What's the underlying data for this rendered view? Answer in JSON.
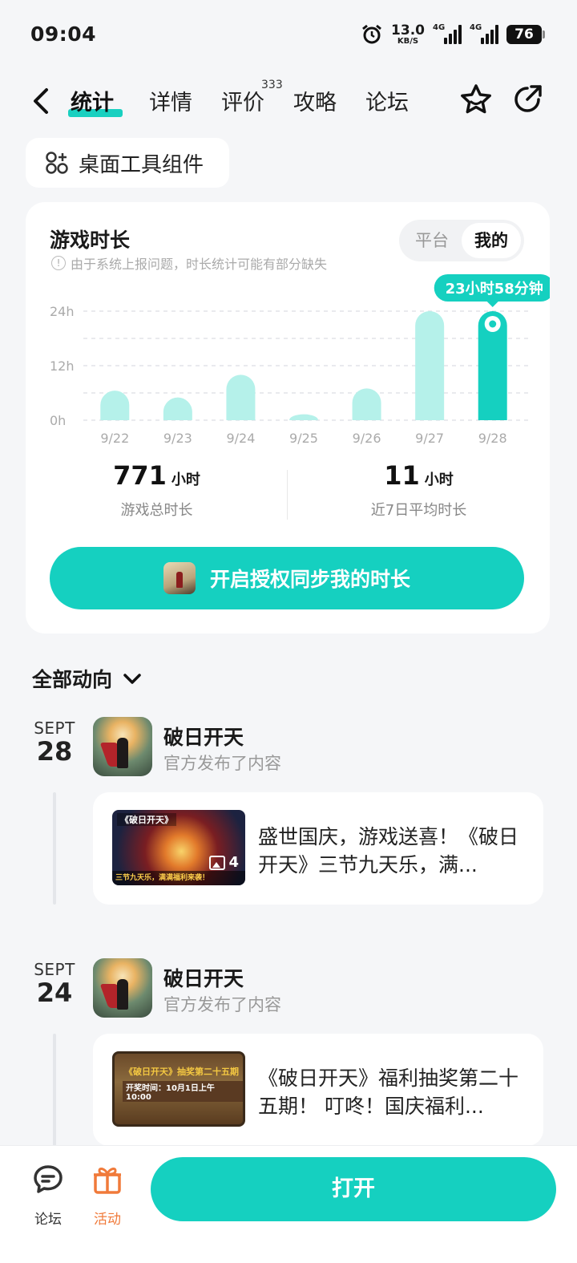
{
  "status_bar": {
    "time": "09:04",
    "speed_value": "13.0",
    "speed_unit": "KB/S",
    "signal1": "4G",
    "signal2": "4G",
    "battery": "76"
  },
  "header": {
    "tabs": [
      {
        "label": "统计"
      },
      {
        "label": "详情"
      },
      {
        "label": "评价"
      },
      {
        "label": "攻略"
      },
      {
        "label": "论坛"
      }
    ],
    "review_count": "333"
  },
  "widget_chip": {
    "label": "桌面工具组件"
  },
  "stats_card": {
    "title": "游戏时长",
    "note": "由于系统上报问题，时长统计可能有部分缺失",
    "toggle": [
      "平台",
      "我的"
    ],
    "tooltip": "23小时58分钟",
    "total_hours": "771",
    "total_unit": "小时",
    "total_label": "游戏总时长",
    "avg_hours": "11",
    "avg_unit": "小时",
    "avg_label": "近7日平均时长",
    "sync_button": "开启授权同步我的时长"
  },
  "chart_data": {
    "type": "bar",
    "categories": [
      "9/22",
      "9/23",
      "9/24",
      "9/25",
      "9/26",
      "9/27",
      "9/28"
    ],
    "values": [
      6.5,
      5,
      10,
      1.3,
      7,
      24,
      24
    ],
    "highlight_index": 6,
    "ylim": [
      0,
      24
    ],
    "yticks": [
      "0h",
      "12h",
      "24h"
    ],
    "colors": {
      "normal": "#b5f1ea",
      "highlight": "#15d0c0"
    }
  },
  "feed": {
    "title": "全部动向",
    "items": [
      {
        "month": "SEPT",
        "day": "28",
        "author": "破日开天",
        "sub": "官方发布了内容",
        "thumb_title": "《破日开天》",
        "thumb_caption": "三节九天乐，满满福利来袭！",
        "image_count": "4",
        "text": "盛世国庆，游戏送喜！《破日开天》三节九天乐，满..."
      },
      {
        "month": "SEPT",
        "day": "24",
        "author": "破日开天",
        "sub": "官方发布了内容",
        "thumb_title": "《破日开天》抽奖第二十五期",
        "thumb_caption": "开奖时间：10月1日上午10:00",
        "text": "《破日开天》福利抽奖第二十五期！ 叮咚！国庆福利..."
      }
    ]
  },
  "bottom_bar": {
    "forum": "论坛",
    "activity": "活动",
    "open": "打开"
  }
}
